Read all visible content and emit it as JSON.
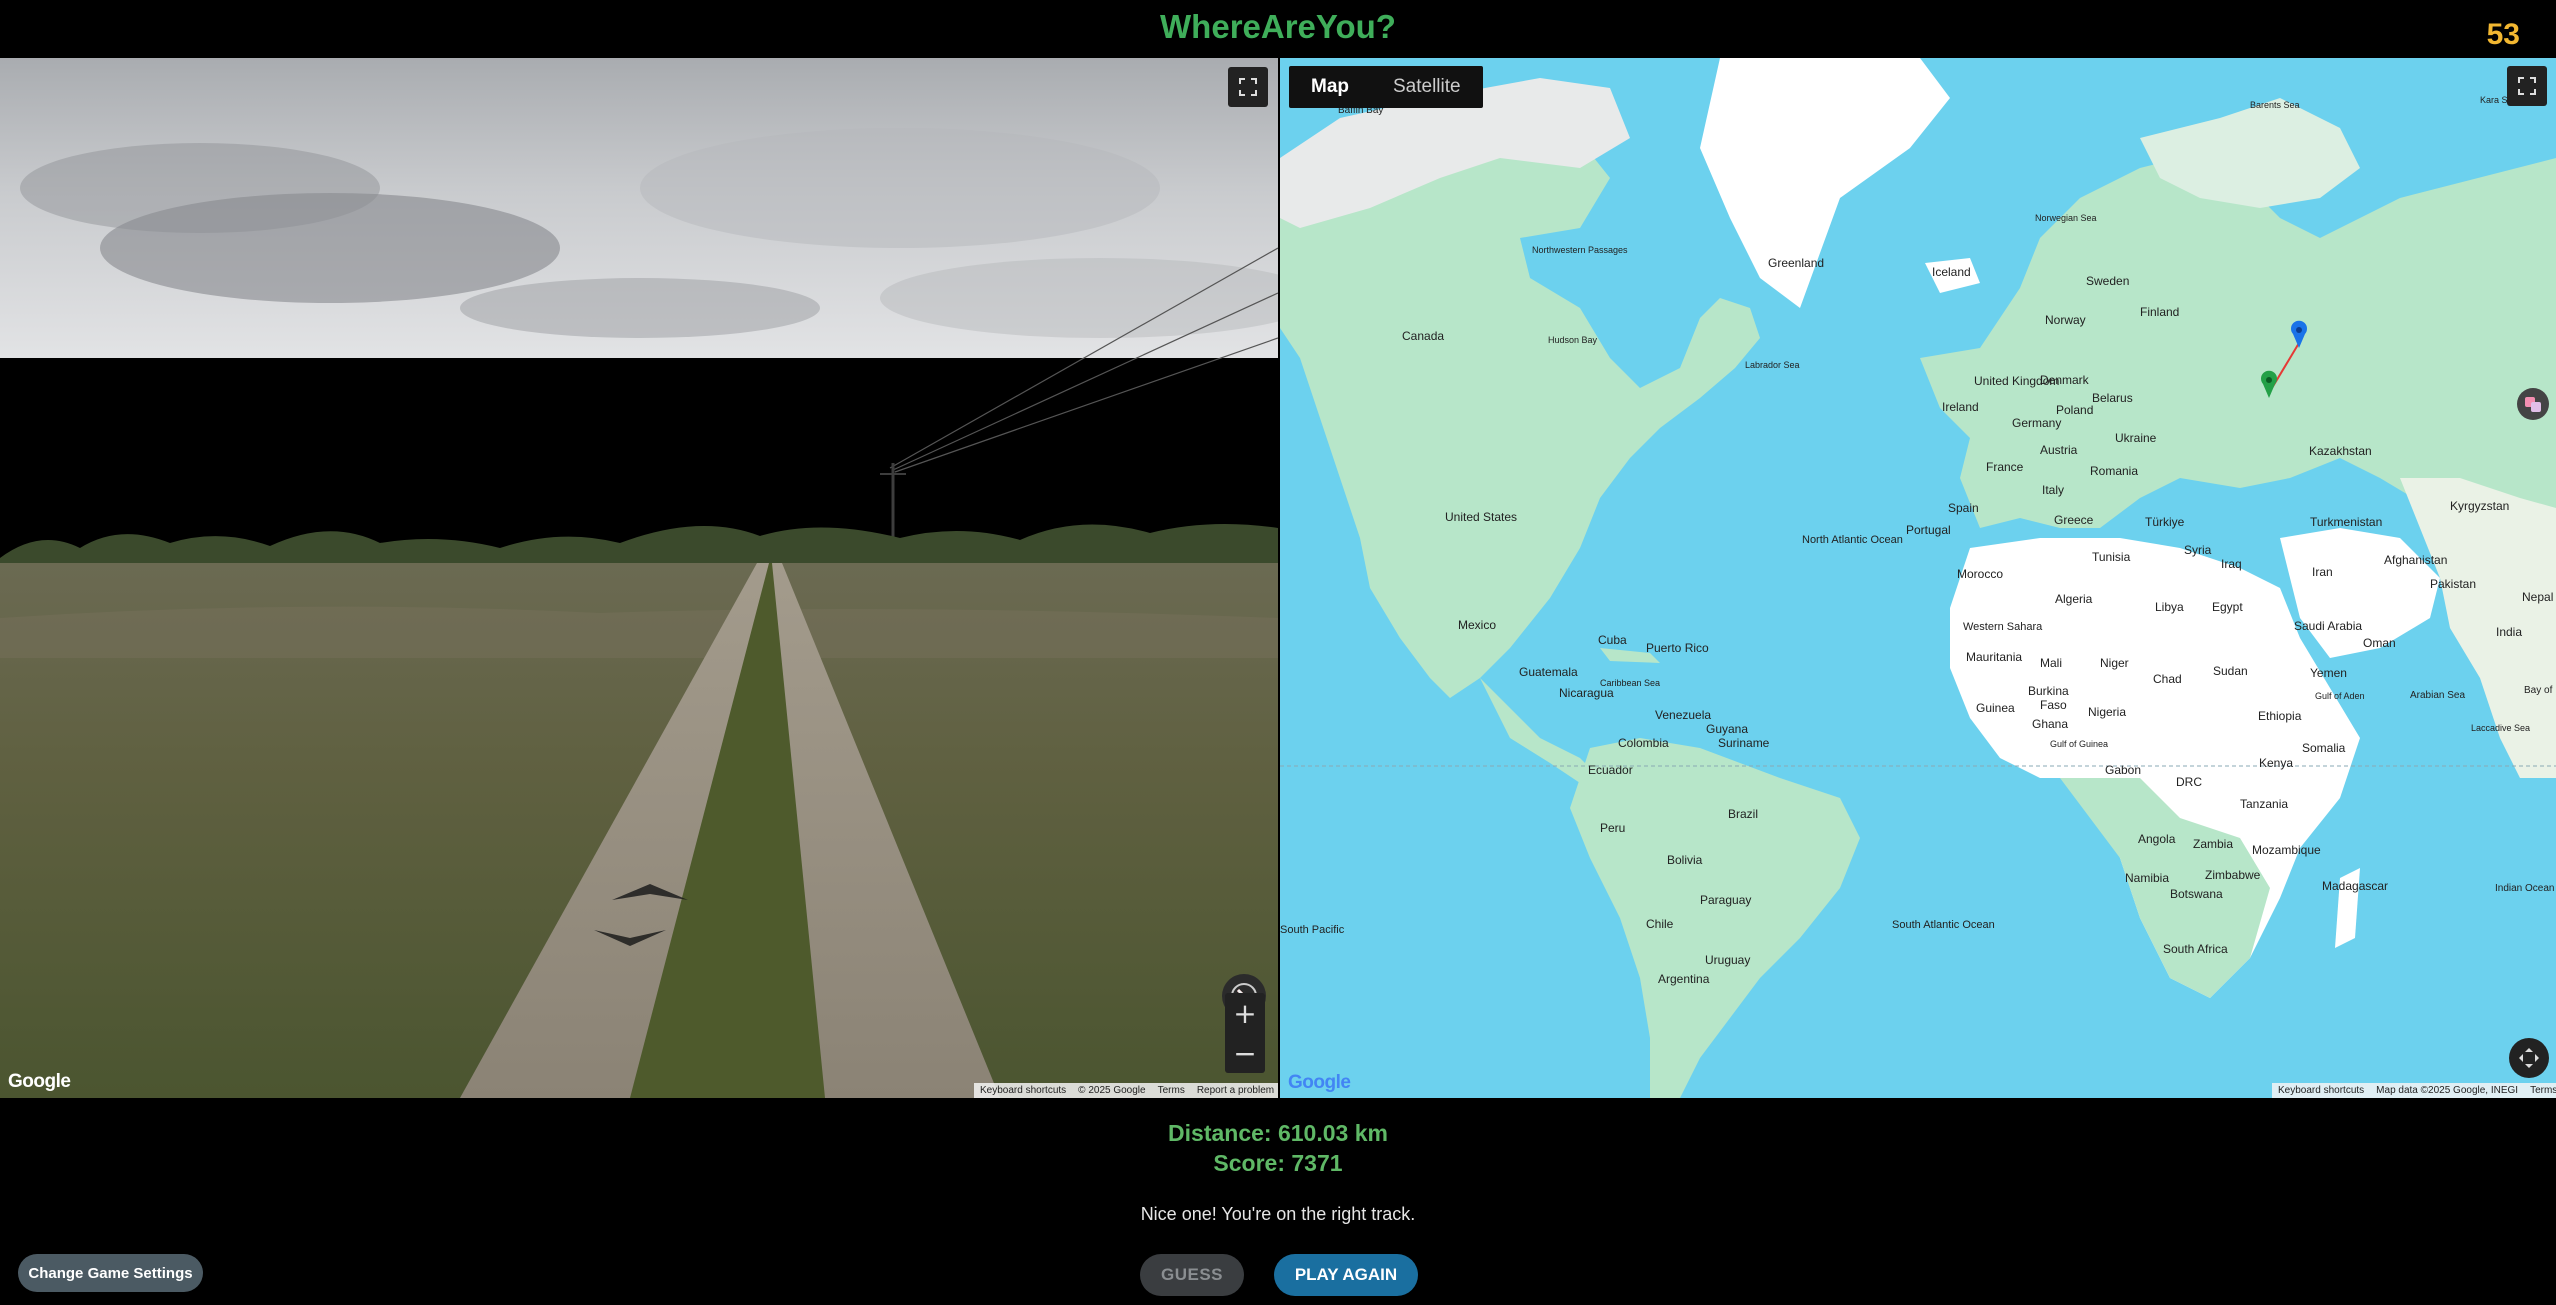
{
  "header": {
    "title": "WhereAreYou?",
    "timer": "53"
  },
  "street_view": {
    "google_logo": "Google",
    "attribution": [
      "Keyboard shortcuts",
      "© 2025 Google",
      "Terms",
      "Report a problem"
    ],
    "zoom_in": "+",
    "zoom_out": "−"
  },
  "map": {
    "type_options": [
      "Map",
      "Satellite"
    ],
    "selected_type": "Map",
    "google_logo": "Google",
    "attribution": [
      "Keyboard shortcuts",
      "Map data ©2025 Google, INEGI",
      "Terms"
    ],
    "labels": {
      "baffin_bay": "Baffin Bay",
      "greenland": "Greenland",
      "iceland": "Iceland",
      "canada": "Canada",
      "nw_passages": "Northwestern Passages",
      "hudson_bay": "Hudson Bay",
      "labrador_sea": "Labrador Sea",
      "norwegian_sea": "Norwegian Sea",
      "barents_sea": "Barents Sea",
      "kara_sea": "Kara Sea",
      "sweden": "Sweden",
      "finland": "Finland",
      "norway": "Norway",
      "uk": "United Kingdom",
      "ireland": "Ireland",
      "denmark": "Denmark",
      "belarus": "Belarus",
      "poland": "Poland",
      "germany": "Germany",
      "ukraine": "Ukraine",
      "kazakhstan": "Kazakhstan",
      "france": "France",
      "austria": "Austria",
      "romania": "Romania",
      "italy": "Italy",
      "spain": "Spain",
      "portugal": "Portugal",
      "greece": "Greece",
      "turkiye": "Türkiye",
      "turkmenistan": "Turkmenistan",
      "kyrgyzstan": "Kyrgyzstan",
      "syria": "Syria",
      "iraq": "Iraq",
      "iran": "Iran",
      "afghanistan": "Afghanistan",
      "pakistan": "Pakistan",
      "nepal": "Nepal",
      "india": "India",
      "tunisia": "Tunisia",
      "morocco": "Morocco",
      "algeria": "Algeria",
      "libya": "Libya",
      "egypt": "Egypt",
      "saudi_arabia": "Saudi Arabia",
      "oman": "Oman",
      "yemen": "Yemen",
      "arabian_sea": "Arabian Sea",
      "bay_of": "Bay of",
      "western_sahara": "Western Sahara",
      "mauritania": "Mauritania",
      "mali": "Mali",
      "niger": "Niger",
      "chad": "Chad",
      "sudan": "Sudan",
      "ethiopia": "Ethiopia",
      "somalia": "Somalia",
      "kenya": "Kenya",
      "guinea": "Guinea",
      "burkina": "Burkina",
      "faso": "Faso",
      "ghana": "Ghana",
      "nigeria": "Nigeria",
      "gulf_of_guinea": "Gulf of Guinea",
      "gabon": "Gabon",
      "drc": "DRC",
      "gulf_of_aden": "Gulf of Aden",
      "tanzania": "Tanzania",
      "angola": "Angola",
      "zambia": "Zambia",
      "mozambique": "Mozambique",
      "namibia": "Namibia",
      "zimbabwe": "Zimbabwe",
      "botswana": "Botswana",
      "madagascar": "Madagascar",
      "south_africa": "South Africa",
      "indian_ocean": "Indian Ocean",
      "laccadive_sea": "Laccadive Sea",
      "united_states": "United States",
      "mexico": "Mexico",
      "cuba": "Cuba",
      "puerto_rico": "Puerto Rico",
      "guatemala": "Guatemala",
      "caribbean_sea": "Caribbean Sea",
      "nicaragua": "Nicaragua",
      "venezuela": "Venezuela",
      "guyana": "Guyana",
      "suriname": "Suriname",
      "colombia": "Colombia",
      "ecuador": "Ecuador",
      "peru": "Peru",
      "brazil": "Brazil",
      "bolivia": "Bolivia",
      "paraguay": "Paraguay",
      "chile": "Chile",
      "uruguay": "Uruguay",
      "argentina": "Argentina",
      "north_atlantic": "North Atlantic Ocean",
      "south_atlantic": "South Atlantic Ocean",
      "south_pacific": "South Pacific"
    },
    "guess_marker_color": "#1a73e8",
    "actual_marker_color": "#23a047",
    "line_color": "#e53935"
  },
  "result": {
    "distance_label": "Distance: 610.03 km",
    "score_label": "Score: 7371",
    "message": "Nice one! You're on the right track."
  },
  "buttons": {
    "settings": "Change Game Settings",
    "guess": "GUESS",
    "play_again": "PLAY AGAIN"
  }
}
